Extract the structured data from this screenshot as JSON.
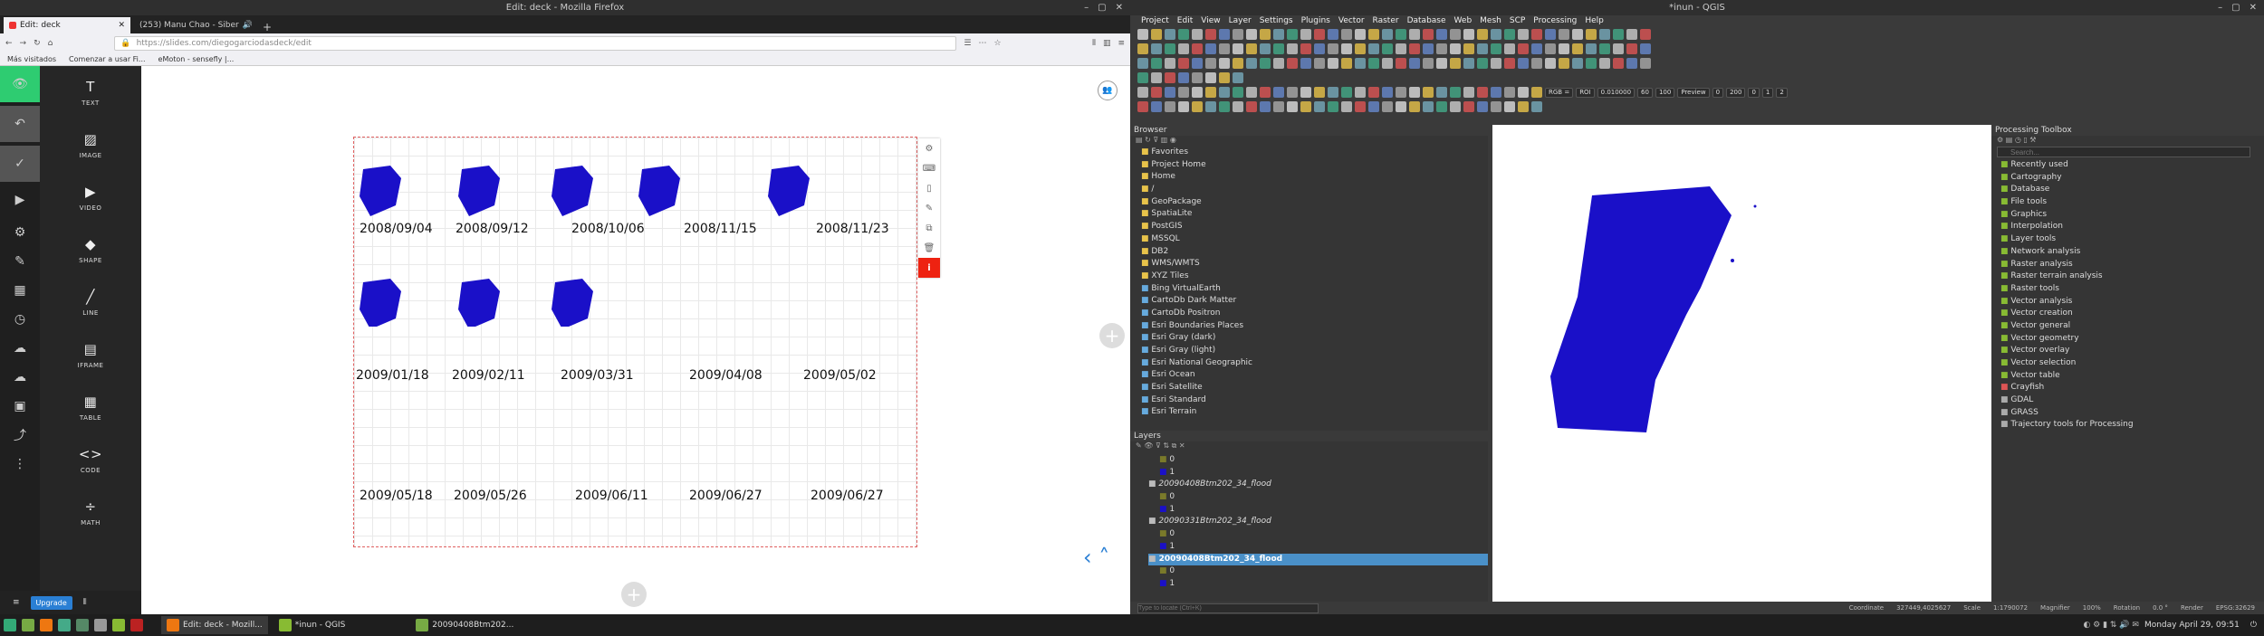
{
  "firefox": {
    "title": "Edit: deck - Mozilla Firefox",
    "tabs": [
      {
        "label": "Edit: deck"
      },
      {
        "label": "(253) Manu Chao - Siber"
      }
    ],
    "url": "https://slides.com/diegogarciodasdeck/edit",
    "url_display": "slides.com/diegogarciodas/deck/edit",
    "bookmarks": [
      "Más visitados",
      "Comenzar a usar Fi...",
      "eMoton - sensefly |..."
    ]
  },
  "slides": {
    "tools": [
      {
        "label": "TEXT",
        "icon": "text-icon"
      },
      {
        "label": "IMAGE",
        "icon": "image-icon"
      },
      {
        "label": "VIDEO",
        "icon": "video-icon"
      },
      {
        "label": "SHAPE",
        "icon": "shape-icon"
      },
      {
        "label": "LINE",
        "icon": "line-icon"
      },
      {
        "label": "IFRAME",
        "icon": "iframe-icon"
      },
      {
        "label": "TABLE",
        "icon": "table-icon"
      },
      {
        "label": "CODE",
        "icon": "code-icon"
      },
      {
        "label": "MATH",
        "icon": "math-icon"
      }
    ],
    "upgrade_label": "Upgrade",
    "dates_row1": [
      "2008/09/04",
      "2008/09/12",
      "2008/10/06",
      "2008/11/15",
      "2008/11/23"
    ],
    "dates_row2": [
      "2009/01/18",
      "2009/02/11",
      "2009/03/31",
      "2009/04/08",
      "2009/05/02"
    ],
    "dates_row3": [
      "2009/05/18",
      "2009/05/26",
      "2009/06/11",
      "2009/06/27",
      "2009/06/27"
    ]
  },
  "qgis": {
    "title": "*inun - QGIS",
    "menu": [
      "Project",
      "Edit",
      "View",
      "Layer",
      "Settings",
      "Plugins",
      "Vector",
      "Raster",
      "Database",
      "Web",
      "Mesh",
      "SCP",
      "Processing",
      "Help"
    ],
    "browser_title": "Browser",
    "browser_items": [
      "Favorites",
      "Project Home",
      "Home",
      "/",
      "GeoPackage",
      "SpatiaLite",
      "PostGIS",
      "MSSQL",
      "DB2",
      "WMS/WMTS",
      "XYZ Tiles",
      "Bing VirtualEarth",
      "CartoDb Dark Matter",
      "CartoDb Positron",
      "Esri Boundaries Places",
      "Esri Gray (dark)",
      "Esri Gray (light)",
      "Esri National Geographic",
      "Esri Ocean",
      "Esri Satellite",
      "Esri Standard",
      "Esri Terrain"
    ],
    "layers_title": "Layers",
    "layers": [
      {
        "label": "0"
      },
      {
        "label": "1"
      },
      {
        "label": "20090408Btm202_34_flood"
      },
      {
        "label": "0"
      },
      {
        "label": "1"
      },
      {
        "label": "20090331Btm202_34_flood"
      },
      {
        "label": "0"
      },
      {
        "label": "1"
      },
      {
        "label": "20090408Btm202_34_flood"
      },
      {
        "label": "0"
      },
      {
        "label": "1"
      }
    ],
    "toolbox_title": "Processing Toolbox",
    "search_placeholder": "Search...",
    "toolbox_items": [
      "Recently used",
      "Cartography",
      "Database",
      "File tools",
      "Graphics",
      "Interpolation",
      "Layer tools",
      "Network analysis",
      "Raster analysis",
      "Raster terrain analysis",
      "Raster tools",
      "Vector analysis",
      "Vector creation",
      "Vector general",
      "Vector geometry",
      "Vector overlay",
      "Vector selection",
      "Vector table",
      "Crayfish",
      "GDAL",
      "GRASS",
      "Trajectory tools for Processing"
    ],
    "scp": {
      "rgb": "RGB =",
      "roi": "ROI",
      "dist": "0.010000",
      "min": "60",
      "max": "100",
      "preview": "Preview",
      "v1": "0",
      "v2": "200",
      "v3": "0",
      "v4": "1",
      "v5": "2"
    },
    "locate_placeholder": "Type to locate (Ctrl+K)",
    "status": {
      "coordinate_label": "Coordinate",
      "coordinate": "327449,4025627",
      "scale_label": "Scale",
      "scale": "1:1790072",
      "magnifier_label": "Magnifier",
      "magnifier": "100%",
      "rotation_label": "Rotation",
      "rotation": "0.0 °",
      "render": "Render",
      "crs": "EPSG:32629"
    }
  },
  "taskbar": {
    "items": [
      "Edit: deck - Mozill...",
      "*inun - QGIS",
      "20090408Btm202..."
    ],
    "clock": "Monday April 29, 09:51"
  }
}
